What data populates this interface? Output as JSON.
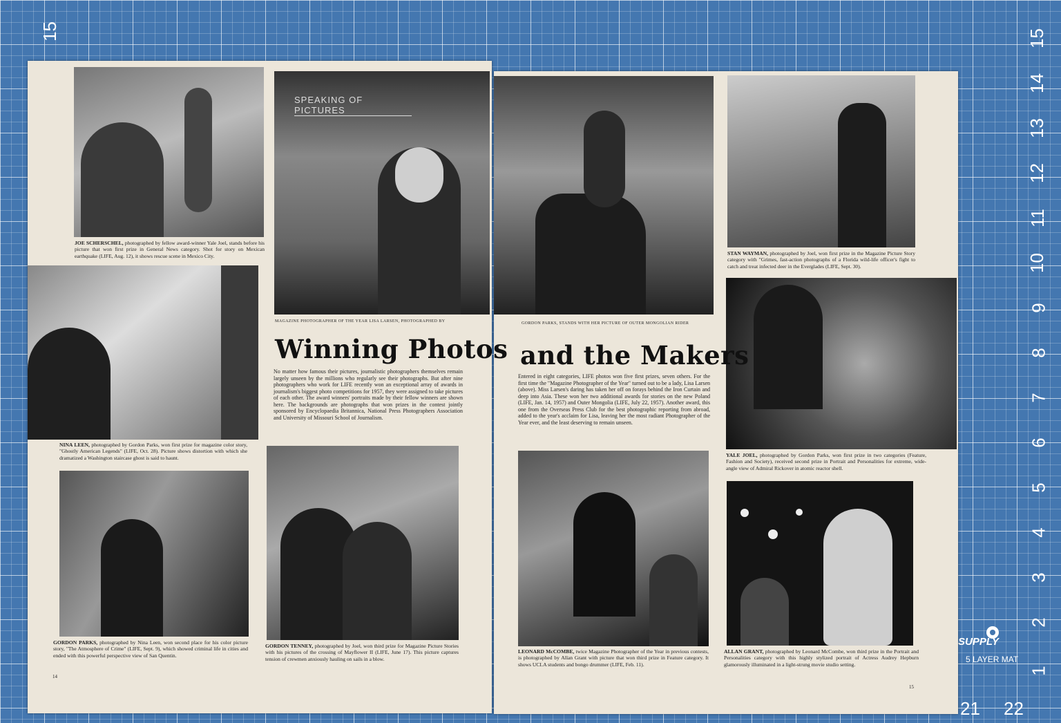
{
  "ruler": {
    "vertical": [
      "15",
      "14",
      "13",
      "12",
      "11",
      "10",
      "9",
      "8",
      "7",
      "6",
      "5",
      "4",
      "3",
      "2",
      "1"
    ],
    "left_mark": "15",
    "bottom": [
      "21",
      "22"
    ],
    "brand": "SUPPLY",
    "brand_sub": "5 LAYER MAT"
  },
  "left_page": {
    "folio": "14",
    "kicker": "SPEAKING OF PICTURES",
    "title": "Winning Photos",
    "lead_caption": "MAGAZINE PHOTOGRAPHER OF THE YEAR LISA LARSEN, PHOTOGRAPHED BY",
    "intro": "No matter how famous their pictures, journalistic photographers themselves remain largely unseen by the millions who regularly see their photographs. But after nine photographers who work for LIFE recently won an exceptional array of awards in journalism's biggest photo competitions for 1957, they were assigned to take pictures of each other. The award winners' portraits made by their fellow winners are shown here. The backgrounds are photographs that won prizes in the contest jointly sponsored by Encyclopaedia Britannica, National Press Photographers Association and University of Missouri School of Journalism.",
    "captions": {
      "scherschel_name": "JOE SCHERSCHEL,",
      "scherschel": "photographed by fellow award-winner Yale Joel, stands before his picture that won first prize in General News category. Shot for story on Mexican earthquake (LIFE, Aug. 12), it shows rescue scene in Mexico City.",
      "leen_name": "NINA LEEN,",
      "leen": "photographed by Gordon Parks, won first prize for magazine color story, \"Ghostly American Legends\" (LIFE, Oct. 28). Picture shows distortion with which she dramatized a Washington staircase ghost is said to haunt.",
      "parks_name": "GORDON PARKS,",
      "parks": "photographed by Nina Leen, won second place for his color picture story, \"The Atmosphere of Crime\" (LIFE, Sept. 9), which showed criminal life in cities and ended with this powerful perspective view of San Quentin.",
      "tenney_name": "GORDON TENNEY,",
      "tenney": "photographed by Joel, won third prize for Magazine Picture Stories with his pictures of the crossing of Mayflower II (LIFE, June 17). This picture captures tension of crewmen anxiously hauling on sails in a blow."
    }
  },
  "right_page": {
    "folio": "15",
    "title": "and the Makers",
    "lead_caption": "GORDON PARKS, STANDS WITH HER PICTURE OF OUTER MONGOLIAN RIDER",
    "intro": "Entered in eight categories, LIFE photos won five first prizes, seven others. For the first time the \"Magazine Photographer of the Year\" turned out to be a lady, Lisa Larsen (above). Miss Larsen's daring has taken her off on forays behind the Iron Curtain and deep into Asia. These won her two additional awards for stories on the new Poland (LIFE, Jan. 14, 1957) and Outer Mongolia (LIFE, July 22, 1957). Another award, this one from the Overseas Press Club for the best photographic reporting from abroad, added to the year's acclaim for Lisa, leaving her the most radiant Photographer of the Year ever, and the least deserving to remain unseen.",
    "captions": {
      "wayman_name": "STAN WAYMAN,",
      "wayman": "photographed by Joel, won first prize in the Magazine Picture Story category with \"Grimes, fast-action photographs of a Florida wild-life officer's fight to catch and treat infected deer in the Everglades (LIFE, Sept. 30).",
      "joel_name": "YALE JOEL,",
      "joel": "photographed by Gordon Parks, won first prize in two categories (Feature, Fashion and Society), received second prize in Portrait and Personalities for extreme, wide-angle view of Admiral Rickover in atomic reactor shell.",
      "mccombe_name": "LEONARD McCOMBE,",
      "mccombe": "twice Magazine Photographer of the Year in previous contests, is photographed by Allan Grant with picture that won third prize in Feature category. It shows UCLA students and bongo drummer (LIFE, Feb. 11).",
      "grant_name": "ALLAN GRANT,",
      "grant": "photographed by Leonard McCombe, won third prize in the Portrait and Personalities category with this highly stylized portrait of Actress Audrey Hepburn glamorously illuminated in a light-strung movie studio setting."
    }
  }
}
